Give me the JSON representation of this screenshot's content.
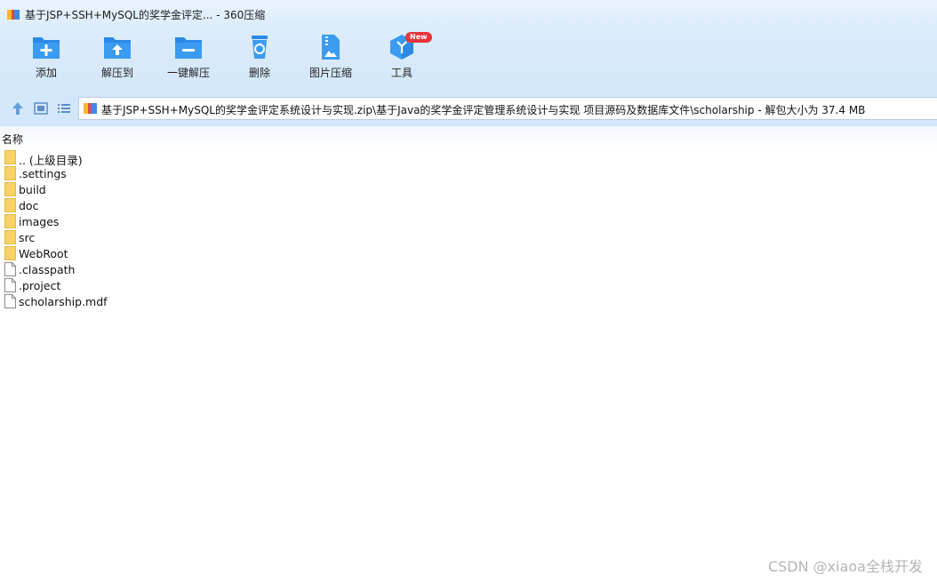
{
  "window": {
    "title": "基于JSP+SSH+MySQL的奖学金评定... - 360压缩",
    "app_icon": "archive-app-icon"
  },
  "toolbar": {
    "items": [
      {
        "label": "添加",
        "icon": "folder-add-icon"
      },
      {
        "label": "解压到",
        "icon": "folder-extract-icon"
      },
      {
        "label": "一键解压",
        "icon": "folder-minus-icon"
      },
      {
        "label": "删除",
        "icon": "recycle-bin-icon"
      },
      {
        "label": "图片压缩",
        "icon": "image-zip-icon"
      },
      {
        "label": "工具",
        "icon": "tools-cube-icon",
        "badge": "New"
      }
    ]
  },
  "nav": {
    "path": "基于JSP+SSH+MySQL的奖学金评定系统设计与实现.zip\\基于Java的奖学金评定管理系统设计与实现 项目源码及数据库文件\\scholarship - 解包大小为 37.4 MB"
  },
  "list": {
    "column_name": "名称",
    "items": [
      {
        "name": ".. (上级目录)",
        "type": "folder"
      },
      {
        "name": ".settings",
        "type": "folder"
      },
      {
        "name": "build",
        "type": "folder"
      },
      {
        "name": "doc",
        "type": "folder"
      },
      {
        "name": "images",
        "type": "folder"
      },
      {
        "name": "src",
        "type": "folder"
      },
      {
        "name": "WebRoot",
        "type": "folder"
      },
      {
        "name": ".classpath",
        "type": "file"
      },
      {
        "name": ".project",
        "type": "file"
      },
      {
        "name": "scholarship.mdf",
        "type": "file"
      }
    ]
  },
  "watermark": "CSDN @xiaoa全栈开发",
  "colors": {
    "accent": "#2a8ae6",
    "badge": "#e8343a",
    "folder": "#f7d267"
  }
}
